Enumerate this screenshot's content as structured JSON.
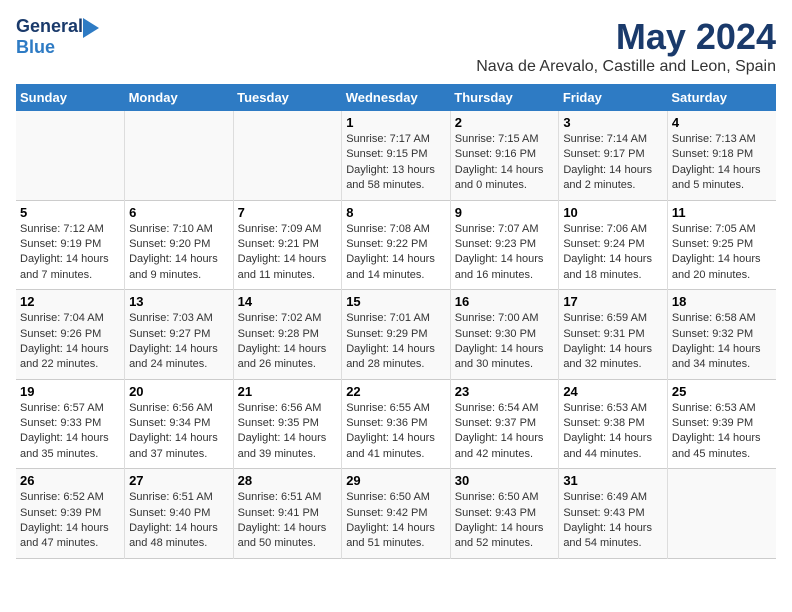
{
  "logo": {
    "line1": "General",
    "line2": "Blue"
  },
  "title": "May 2024",
  "location": "Nava de Arevalo, Castille and Leon, Spain",
  "headers": [
    "Sunday",
    "Monday",
    "Tuesday",
    "Wednesday",
    "Thursday",
    "Friday",
    "Saturday"
  ],
  "weeks": [
    [
      {
        "day": "",
        "lines": []
      },
      {
        "day": "",
        "lines": []
      },
      {
        "day": "",
        "lines": []
      },
      {
        "day": "1",
        "lines": [
          "Sunrise: 7:17 AM",
          "Sunset: 9:15 PM",
          "Daylight: 13 hours",
          "and 58 minutes."
        ]
      },
      {
        "day": "2",
        "lines": [
          "Sunrise: 7:15 AM",
          "Sunset: 9:16 PM",
          "Daylight: 14 hours",
          "and 0 minutes."
        ]
      },
      {
        "day": "3",
        "lines": [
          "Sunrise: 7:14 AM",
          "Sunset: 9:17 PM",
          "Daylight: 14 hours",
          "and 2 minutes."
        ]
      },
      {
        "day": "4",
        "lines": [
          "Sunrise: 7:13 AM",
          "Sunset: 9:18 PM",
          "Daylight: 14 hours",
          "and 5 minutes."
        ]
      }
    ],
    [
      {
        "day": "5",
        "lines": [
          "Sunrise: 7:12 AM",
          "Sunset: 9:19 PM",
          "Daylight: 14 hours",
          "and 7 minutes."
        ]
      },
      {
        "day": "6",
        "lines": [
          "Sunrise: 7:10 AM",
          "Sunset: 9:20 PM",
          "Daylight: 14 hours",
          "and 9 minutes."
        ]
      },
      {
        "day": "7",
        "lines": [
          "Sunrise: 7:09 AM",
          "Sunset: 9:21 PM",
          "Daylight: 14 hours",
          "and 11 minutes."
        ]
      },
      {
        "day": "8",
        "lines": [
          "Sunrise: 7:08 AM",
          "Sunset: 9:22 PM",
          "Daylight: 14 hours",
          "and 14 minutes."
        ]
      },
      {
        "day": "9",
        "lines": [
          "Sunrise: 7:07 AM",
          "Sunset: 9:23 PM",
          "Daylight: 14 hours",
          "and 16 minutes."
        ]
      },
      {
        "day": "10",
        "lines": [
          "Sunrise: 7:06 AM",
          "Sunset: 9:24 PM",
          "Daylight: 14 hours",
          "and 18 minutes."
        ]
      },
      {
        "day": "11",
        "lines": [
          "Sunrise: 7:05 AM",
          "Sunset: 9:25 PM",
          "Daylight: 14 hours",
          "and 20 minutes."
        ]
      }
    ],
    [
      {
        "day": "12",
        "lines": [
          "Sunrise: 7:04 AM",
          "Sunset: 9:26 PM",
          "Daylight: 14 hours",
          "and 22 minutes."
        ]
      },
      {
        "day": "13",
        "lines": [
          "Sunrise: 7:03 AM",
          "Sunset: 9:27 PM",
          "Daylight: 14 hours",
          "and 24 minutes."
        ]
      },
      {
        "day": "14",
        "lines": [
          "Sunrise: 7:02 AM",
          "Sunset: 9:28 PM",
          "Daylight: 14 hours",
          "and 26 minutes."
        ]
      },
      {
        "day": "15",
        "lines": [
          "Sunrise: 7:01 AM",
          "Sunset: 9:29 PM",
          "Daylight: 14 hours",
          "and 28 minutes."
        ]
      },
      {
        "day": "16",
        "lines": [
          "Sunrise: 7:00 AM",
          "Sunset: 9:30 PM",
          "Daylight: 14 hours",
          "and 30 minutes."
        ]
      },
      {
        "day": "17",
        "lines": [
          "Sunrise: 6:59 AM",
          "Sunset: 9:31 PM",
          "Daylight: 14 hours",
          "and 32 minutes."
        ]
      },
      {
        "day": "18",
        "lines": [
          "Sunrise: 6:58 AM",
          "Sunset: 9:32 PM",
          "Daylight: 14 hours",
          "and 34 minutes."
        ]
      }
    ],
    [
      {
        "day": "19",
        "lines": [
          "Sunrise: 6:57 AM",
          "Sunset: 9:33 PM",
          "Daylight: 14 hours",
          "and 35 minutes."
        ]
      },
      {
        "day": "20",
        "lines": [
          "Sunrise: 6:56 AM",
          "Sunset: 9:34 PM",
          "Daylight: 14 hours",
          "and 37 minutes."
        ]
      },
      {
        "day": "21",
        "lines": [
          "Sunrise: 6:56 AM",
          "Sunset: 9:35 PM",
          "Daylight: 14 hours",
          "and 39 minutes."
        ]
      },
      {
        "day": "22",
        "lines": [
          "Sunrise: 6:55 AM",
          "Sunset: 9:36 PM",
          "Daylight: 14 hours",
          "and 41 minutes."
        ]
      },
      {
        "day": "23",
        "lines": [
          "Sunrise: 6:54 AM",
          "Sunset: 9:37 PM",
          "Daylight: 14 hours",
          "and 42 minutes."
        ]
      },
      {
        "day": "24",
        "lines": [
          "Sunrise: 6:53 AM",
          "Sunset: 9:38 PM",
          "Daylight: 14 hours",
          "and 44 minutes."
        ]
      },
      {
        "day": "25",
        "lines": [
          "Sunrise: 6:53 AM",
          "Sunset: 9:39 PM",
          "Daylight: 14 hours",
          "and 45 minutes."
        ]
      }
    ],
    [
      {
        "day": "26",
        "lines": [
          "Sunrise: 6:52 AM",
          "Sunset: 9:39 PM",
          "Daylight: 14 hours",
          "and 47 minutes."
        ]
      },
      {
        "day": "27",
        "lines": [
          "Sunrise: 6:51 AM",
          "Sunset: 9:40 PM",
          "Daylight: 14 hours",
          "and 48 minutes."
        ]
      },
      {
        "day": "28",
        "lines": [
          "Sunrise: 6:51 AM",
          "Sunset: 9:41 PM",
          "Daylight: 14 hours",
          "and 50 minutes."
        ]
      },
      {
        "day": "29",
        "lines": [
          "Sunrise: 6:50 AM",
          "Sunset: 9:42 PM",
          "Daylight: 14 hours",
          "and 51 minutes."
        ]
      },
      {
        "day": "30",
        "lines": [
          "Sunrise: 6:50 AM",
          "Sunset: 9:43 PM",
          "Daylight: 14 hours",
          "and 52 minutes."
        ]
      },
      {
        "day": "31",
        "lines": [
          "Sunrise: 6:49 AM",
          "Sunset: 9:43 PM",
          "Daylight: 14 hours",
          "and 54 minutes."
        ]
      },
      {
        "day": "",
        "lines": []
      }
    ]
  ]
}
